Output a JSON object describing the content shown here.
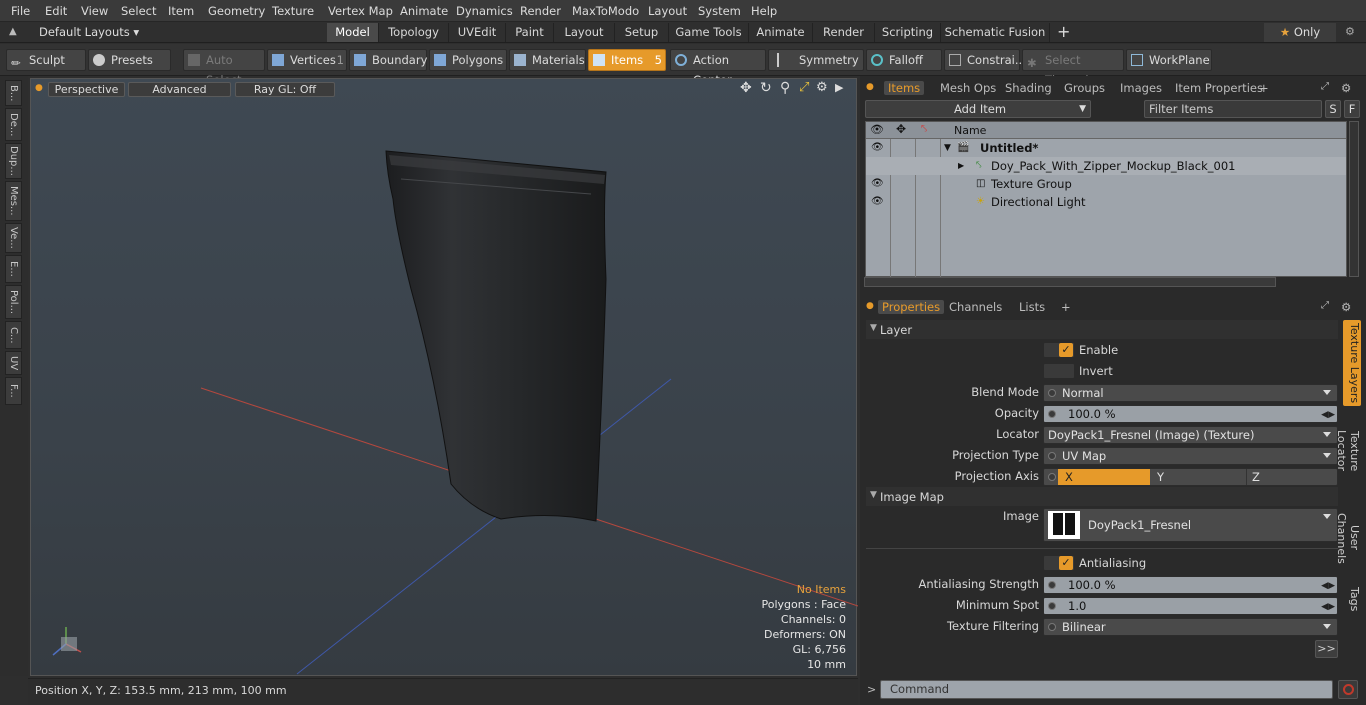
{
  "menu": [
    "File",
    "Edit",
    "View",
    "Select",
    "Item",
    "Geometry",
    "Texture",
    "Vertex Map",
    "Animate",
    "Dynamics",
    "Render",
    "MaxToModo",
    "Layout",
    "System",
    "Help"
  ],
  "layouts": {
    "default_label": "Default Layouts",
    "tabs": [
      "Model",
      "Topology",
      "UVEdit",
      "Paint",
      "Layout",
      "Setup",
      "Game Tools",
      "Animate",
      "Render",
      "Scripting",
      "Schematic Fusion"
    ],
    "active_tab": "Model",
    "only_label": "Only"
  },
  "toolbar": {
    "sculpt": "Sculpt",
    "presets": "Presets",
    "auto_select": "Auto Select",
    "vertices": "Vertices",
    "vertices_count": "1",
    "boundary": "Boundary",
    "polygons": "Polygons",
    "materials": "Materials",
    "items": "Items",
    "items_count": "5",
    "action_center": "Action Center",
    "symmetry": "Symmetry",
    "falloff": "Falloff",
    "constraints": "Constrai...",
    "select_through": "Select Through",
    "workplane": "WorkPlane"
  },
  "left_tabs": [
    "B...",
    "De...",
    "Dup...",
    "Mes...",
    "Ve...",
    "E...",
    "Pol...",
    "C...",
    "UV",
    "F..."
  ],
  "viewport": {
    "perspective": "Perspective",
    "advanced": "Advanced",
    "raygl": "Ray GL: Off",
    "info": {
      "no_items": "No Items",
      "polygons": "Polygons : Face",
      "channels": "Channels: 0",
      "deformers": "Deformers: ON",
      "gl": "GL: 6,756",
      "scale": "10 mm"
    }
  },
  "status": {
    "position": "Position X, Y, Z:   153.5 mm, 213 mm, 100 mm"
  },
  "items_panel": {
    "tabs": [
      "Items",
      "Mesh Ops",
      "Shading",
      "Groups",
      "Images",
      "Item Properties"
    ],
    "add_item": "Add Item",
    "filter_placeholder": "Filter Items",
    "s": "S",
    "f": "F",
    "name_header": "Name",
    "rows": [
      "Untitled*",
      "Doy_Pack_With_Zipper_Mockup_Black_001",
      "Texture Group",
      "Directional Light"
    ]
  },
  "properties_panel": {
    "tabs": [
      "Properties",
      "Channels",
      "Lists"
    ],
    "layer_section": "Layer",
    "enable": "Enable",
    "invert": "Invert",
    "blend_mode_label": "Blend Mode",
    "blend_mode": "Normal",
    "opacity_label": "Opacity",
    "opacity": "100.0 %",
    "locator_label": "Locator",
    "locator": "DoyPack1_Fresnel (Image) (Texture)",
    "projection_type_label": "Projection Type",
    "projection_type": "UV Map",
    "projection_axis_label": "Projection Axis",
    "axis_x": "X",
    "axis_y": "Y",
    "axis_z": "Z",
    "image_map_section": "Image Map",
    "image_label": "Image",
    "image": "DoyPack1_Fresnel",
    "antialiasing": "Antialiasing",
    "aa_strength_label": "Antialiasing Strength",
    "aa_strength": "100.0 %",
    "min_spot_label": "Minimum Spot",
    "min_spot": "1.0",
    "tex_filter_label": "Texture Filtering",
    "tex_filter": "Bilinear",
    "more": ">>",
    "side_tabs": [
      "Texture Layers",
      "Texture Locator",
      "User Channels",
      "Tags"
    ]
  },
  "command": {
    "placeholder": "Command"
  },
  "colors": {
    "accent": "#e69a2a"
  }
}
